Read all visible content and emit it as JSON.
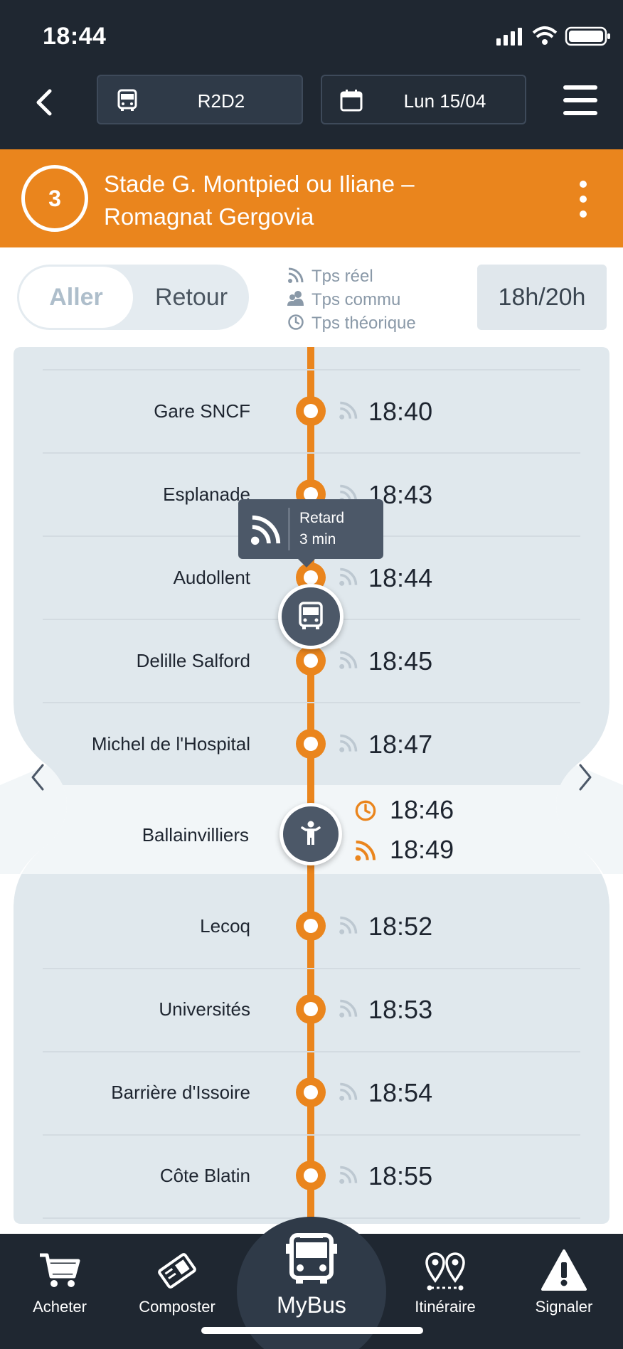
{
  "status_bar": {
    "time": "18:44"
  },
  "nav": {
    "line_value": "R2D2",
    "date_value": "Lun 15/04"
  },
  "line": {
    "number": "3",
    "name_line1": "Stade G. Montpied ou Iliane –",
    "name_line2": "Romagnat Gergovia",
    "color": "#ea851d"
  },
  "direction": {
    "active": "Aller",
    "inactive": "Retour"
  },
  "legend": {
    "realtime": "Tps réel",
    "community": "Tps commu",
    "theoretical": "Tps théorique"
  },
  "time_range": "18h/20h",
  "stops_before": [
    {
      "name": "Gare SNCF",
      "time": "18:40"
    },
    {
      "name": "Esplanade",
      "time": "18:43"
    },
    {
      "name": "Audollent",
      "time": "18:44"
    },
    {
      "name": "Delille Salford",
      "time": "18:45"
    },
    {
      "name": "Michel de l'Hospital",
      "time": "18:47"
    }
  ],
  "current_stop": {
    "name": "Ballainvilliers",
    "theoretical_time": "18:46",
    "realtime_time": "18:49"
  },
  "stops_after": [
    {
      "name": "Lecoq",
      "time": "18:52"
    },
    {
      "name": "Universités",
      "time": "18:53"
    },
    {
      "name": "Barrière d'Issoire",
      "time": "18:54"
    },
    {
      "name": "Côte Blatin",
      "time": "18:55"
    }
  ],
  "tooltip": {
    "line1": "Retard",
    "line2": "3 min"
  },
  "tabs": {
    "buy": "Acheter",
    "validate": "Composter",
    "mybus": "MyBus",
    "itinerary": "Itinéraire",
    "report": "Signaler"
  },
  "icons": [
    "back-icon",
    "bus-icon",
    "calendar-icon",
    "menu-icon",
    "more-icon",
    "rss-icon",
    "people-icon",
    "clock-icon",
    "person-icon",
    "cart-icon",
    "ticket-icon",
    "map-pin-icon",
    "warning-icon",
    "chevron-left-icon",
    "chevron-right-icon"
  ]
}
